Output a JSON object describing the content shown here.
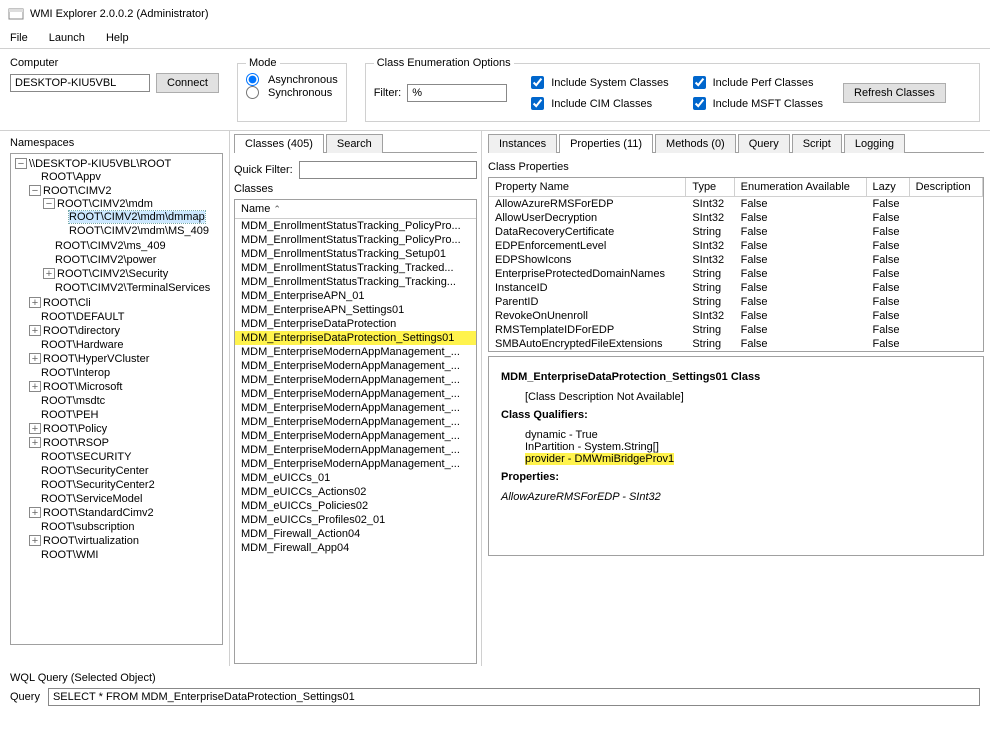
{
  "title": "WMI Explorer 2.0.0.2 (Administrator)",
  "menu": {
    "file": "File",
    "launch": "Launch",
    "help": "Help"
  },
  "computer": {
    "label": "Computer",
    "value": "DESKTOP-KIU5VBL",
    "connect": "Connect"
  },
  "mode": {
    "legend": "Mode",
    "async": "Asynchronous",
    "sync": "Synchronous",
    "selected": "async"
  },
  "enum": {
    "legend": "Class Enumeration Options",
    "filterLabel": "Filter:",
    "filterValue": "%",
    "sys": "Include System Classes",
    "cim": "Include CIM Classes",
    "perf": "Include Perf Classes",
    "msft": "Include MSFT Classes",
    "refresh": "Refresh Classes"
  },
  "namespaces": {
    "label": "Namespaces",
    "root": "\\\\DESKTOP-KIU5VBL\\ROOT",
    "n_appv": "ROOT\\Appv",
    "n_cimv2": "ROOT\\CIMV2",
    "n_mdm": "ROOT\\CIMV2\\mdm",
    "n_dmmap": "ROOT\\CIMV2\\mdm\\dmmap",
    "n_ms409": "ROOT\\CIMV2\\mdm\\MS_409",
    "n_cms409": "ROOT\\CIMV2\\ms_409",
    "n_power": "ROOT\\CIMV2\\power",
    "n_sec": "ROOT\\CIMV2\\Security",
    "n_ts": "ROOT\\CIMV2\\TerminalServices",
    "n_cli": "ROOT\\Cli",
    "n_default": "ROOT\\DEFAULT",
    "n_dir": "ROOT\\directory",
    "n_hw": "ROOT\\Hardware",
    "n_hv": "ROOT\\HyperVCluster",
    "n_interop": "ROOT\\Interop",
    "n_msft": "ROOT\\Microsoft",
    "n_msdtc": "ROOT\\msdtc",
    "n_peh": "ROOT\\PEH",
    "n_policy": "ROOT\\Policy",
    "n_rsop": "ROOT\\RSOP",
    "n_security": "ROOT\\SECURITY",
    "n_sc": "ROOT\\SecurityCenter",
    "n_sc2": "ROOT\\SecurityCenter2",
    "n_sm": "ROOT\\ServiceModel",
    "n_std": "ROOT\\StandardCimv2",
    "n_sub": "ROOT\\subscription",
    "n_virt": "ROOT\\virtualization",
    "n_wmi": "ROOT\\WMI"
  },
  "classesTab": {
    "label": "Classes (405)",
    "search": "Search"
  },
  "quickFilter": {
    "label": "Quick Filter:",
    "value": ""
  },
  "classesHeader": {
    "label": "Classes",
    "col": "Name"
  },
  "classes": [
    "MDM_EnrollmentStatusTracking_PolicyPro...",
    "MDM_EnrollmentStatusTracking_PolicyPro...",
    "MDM_EnrollmentStatusTracking_Setup01",
    "MDM_EnrollmentStatusTracking_Tracked...",
    "MDM_EnrollmentStatusTracking_Tracking...",
    "MDM_EnterpriseAPN_01",
    "MDM_EnterpriseAPN_Settings01",
    "MDM_EnterpriseDataProtection",
    "MDM_EnterpriseDataProtection_Settings01",
    "MDM_EnterpriseModernAppManagement_...",
    "MDM_EnterpriseModernAppManagement_...",
    "MDM_EnterpriseModernAppManagement_...",
    "MDM_EnterpriseModernAppManagement_...",
    "MDM_EnterpriseModernAppManagement_...",
    "MDM_EnterpriseModernAppManagement_...",
    "MDM_EnterpriseModernAppManagement_...",
    "MDM_EnterpriseModernAppManagement_...",
    "MDM_EnterpriseModernAppManagement_...",
    "MDM_eUICCs_01",
    "MDM_eUICCs_Actions02",
    "MDM_eUICCs_Policies02",
    "MDM_eUICCs_Profiles02_01",
    "MDM_Firewall_Action04",
    "MDM_Firewall_App04"
  ],
  "classesSelectedIndex": 8,
  "rightTabs": {
    "instances": "Instances",
    "properties": "Properties (11)",
    "methods": "Methods (0)",
    "query": "Query",
    "script": "Script",
    "logging": "Logging"
  },
  "propTableTitle": "Class Properties",
  "propCols": {
    "name": "Property Name",
    "type": "Type",
    "enum": "Enumeration Available",
    "lazy": "Lazy",
    "desc": "Description"
  },
  "props": [
    {
      "name": "AllowAzureRMSForEDP",
      "type": "SInt32",
      "enum": "False",
      "lazy": "False"
    },
    {
      "name": "AllowUserDecryption",
      "type": "SInt32",
      "enum": "False",
      "lazy": "False"
    },
    {
      "name": "DataRecoveryCertificate",
      "type": "String",
      "enum": "False",
      "lazy": "False"
    },
    {
      "name": "EDPEnforcementLevel",
      "type": "SInt32",
      "enum": "False",
      "lazy": "False"
    },
    {
      "name": "EDPShowIcons",
      "type": "SInt32",
      "enum": "False",
      "lazy": "False"
    },
    {
      "name": "EnterpriseProtectedDomainNames",
      "type": "String",
      "enum": "False",
      "lazy": "False"
    },
    {
      "name": "InstanceID",
      "type": "String",
      "enum": "False",
      "lazy": "False"
    },
    {
      "name": "ParentID",
      "type": "String",
      "enum": "False",
      "lazy": "False"
    },
    {
      "name": "RevokeOnUnenroll",
      "type": "SInt32",
      "enum": "False",
      "lazy": "False"
    },
    {
      "name": "RMSTemplateIDForEDP",
      "type": "String",
      "enum": "False",
      "lazy": "False"
    },
    {
      "name": "SMBAutoEncryptedFileExtensions",
      "type": "String",
      "enum": "False",
      "lazy": "False"
    }
  ],
  "detail": {
    "classTitle": "MDM_EnterpriseDataProtection_Settings01 Class",
    "noDesc": "[Class Description Not Available]",
    "qualHeader": "Class Qualifiers:",
    "q1": "dynamic - True",
    "q2": "InPartition - System.String[]",
    "q3": "provider - DMWmiBridgeProv1",
    "propsHeader": "Properties:",
    "p1": "AllowAzureRMSForEDP - SInt32"
  },
  "wql": {
    "label": "WQL Query (Selected Object)",
    "queryLabel": "Query",
    "value": "SELECT * FROM MDM_EnterpriseDataProtection_Settings01"
  }
}
